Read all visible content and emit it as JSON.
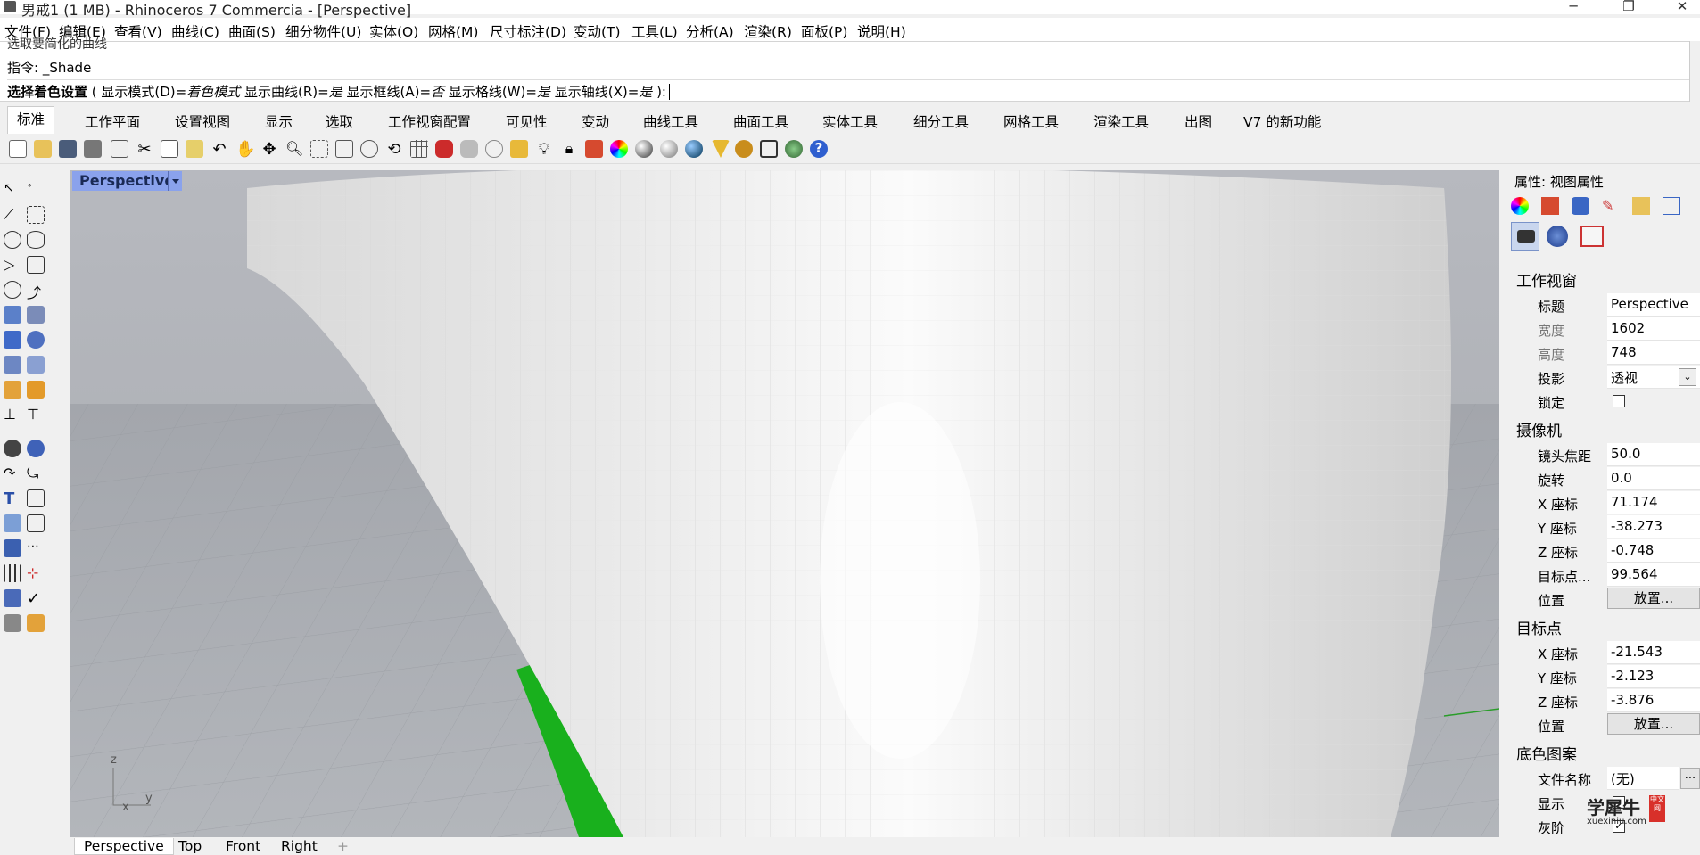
{
  "title": "男戒1 (1 MB) - Rhinoceros 7 Commercia - [Perspective]",
  "menu": [
    "文件(F)",
    "编辑(E)",
    "查看(V)",
    "曲线(C)",
    "曲面(S)",
    "细分物件(U)",
    "实体(O)",
    "网格(M)",
    "尺寸标注(D)",
    "变动(T)",
    "工具(L)",
    "分析(A)",
    "渲染(R)",
    "面板(P)",
    "说明(H)"
  ],
  "command": {
    "prev_line": "选取要简化的曲线",
    "line1": "指令: _Shade",
    "prompt_bold": "选择着色设置",
    "prompt_rest_a": " ( 显示模式(D)=",
    "prompt_mode": "着色模式",
    "prompt_rest_b": " 显示曲线(R)=",
    "prompt_v1": "是",
    "prompt_rest_c": " 显示框线(A)=",
    "prompt_v2": "否",
    "prompt_rest_d": " 显示格线(W)=",
    "prompt_v3": "是",
    "prompt_rest_e": " 显示轴线(X)=",
    "prompt_v4": "是",
    "prompt_end": " ):"
  },
  "tabs": [
    "标准",
    "工作平面",
    "设置视图",
    "显示",
    "选取",
    "工作视窗配置",
    "可见性",
    "变动",
    "曲线工具",
    "曲面工具",
    "实体工具",
    "细分工具",
    "网格工具",
    "渲染工具",
    "出图",
    "V7 的新功能"
  ],
  "viewport": {
    "label": "Perspective",
    "axis_z": "z",
    "axis_x": "x",
    "axis_y": "y"
  },
  "view_tabs": [
    "Perspective",
    "Top",
    "Front",
    "Right"
  ],
  "panel": {
    "title": "属性: 视图属性",
    "sections": {
      "viewport": "工作视窗",
      "camera": "摄像机",
      "target": "目标点",
      "wallpaper": "底色图案"
    },
    "rows": {
      "title_label": "标题",
      "title_value": "Perspective",
      "width_label": "宽度",
      "width_value": "1602",
      "height_label": "高度",
      "height_value": "748",
      "proj_label": "投影",
      "proj_value": "透视",
      "lock_label": "锁定",
      "lens_label": "镜头焦距",
      "lens_value": "50.0",
      "rot_label": "旋转",
      "rot_value": "0.0",
      "camx_label": "X 座标",
      "camx_value": "71.174",
      "camy_label": "Y 座标",
      "camy_value": "-38.273",
      "camz_label": "Z 座标",
      "camz_value": "-0.748",
      "tdist_label": "目标点...",
      "tdist_value": "99.564",
      "pos_label": "位置",
      "pos_button": "放置...",
      "tx_label": "X 座标",
      "tx_value": "-21.543",
      "ty_label": "Y 座标",
      "ty_value": "-2.123",
      "tz_label": "Z 座标",
      "tz_value": "-3.876",
      "tpos_label": "位置",
      "tpos_button": "放置...",
      "file_label": "文件名称",
      "file_value": "(无)",
      "file_button": "...",
      "show_label": "显示",
      "gray_label": "灰阶"
    }
  },
  "watermark": {
    "text": "学犀牛",
    "sub": "xuexiniu.com",
    "badge": "中文网"
  },
  "colors": {
    "viewport_bg": "#a9acb1",
    "label_bg": "#8aa2ec",
    "surface": "#e9e9e9",
    "green": "#19b01d"
  }
}
